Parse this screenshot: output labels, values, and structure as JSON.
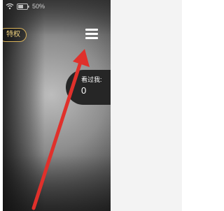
{
  "status_bar": {
    "battery_text": "50%",
    "wifi_icon": "wifi-icon",
    "battery_icon": "battery-icon"
  },
  "privilege_badge": {
    "label": "特权"
  },
  "menu": {
    "icon": "hamburger-menu-icon"
  },
  "visitors": {
    "label": "看过我:",
    "count": "0"
  },
  "annotation": {
    "arrow_color": "#e0302b"
  },
  "colors": {
    "badge_gold": "#d8b25a",
    "card_background": "#262626",
    "side_panel": "#f3f3f3"
  }
}
